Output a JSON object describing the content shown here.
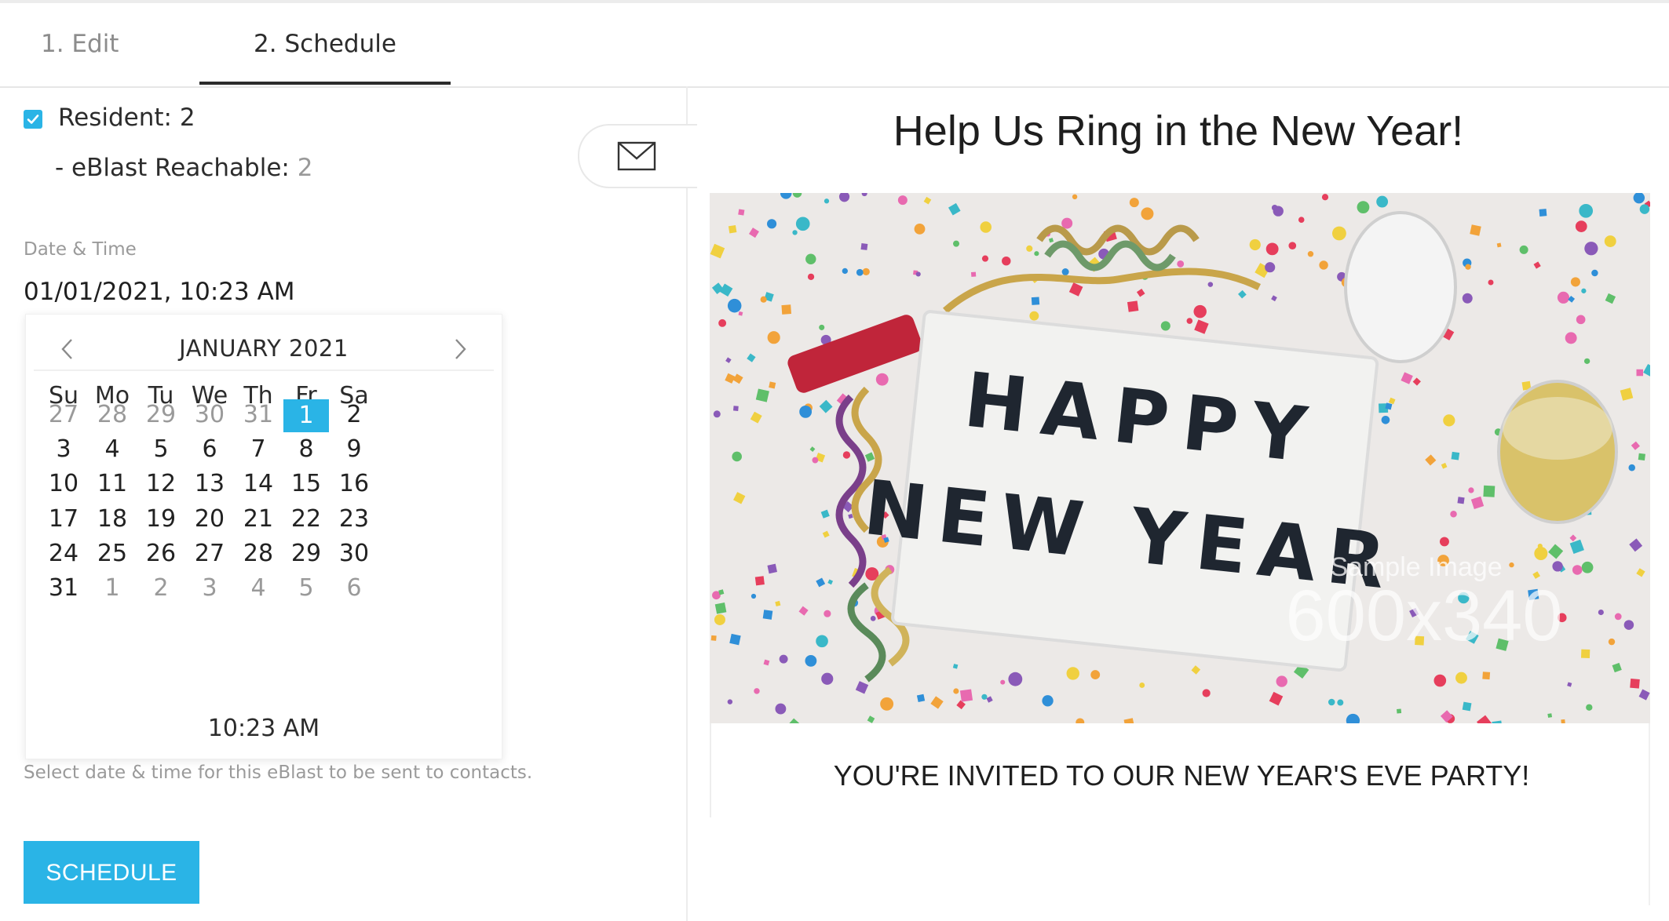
{
  "tabs": [
    {
      "label": "1. Edit",
      "active": false
    },
    {
      "label": "2. Schedule",
      "active": true
    }
  ],
  "recipients": {
    "resident_label": "Resident: 2",
    "resident_checked": true,
    "reachable_label": "- eBlast Reachable: ",
    "reachable_count": "2"
  },
  "datetime": {
    "label": "Date & Time",
    "value": "01/01/2021, 10:23 AM",
    "hint": "Select date & time for this eBlast to be sent to contacts."
  },
  "calendar": {
    "month_title": "JANUARY 2021",
    "weekdays": [
      "Su",
      "Mo",
      "Tu",
      "We",
      "Th",
      "Fr",
      "Sa"
    ],
    "weeks": [
      [
        "27",
        "28",
        "29",
        "30",
        "31",
        "1",
        "2"
      ],
      [
        "3",
        "4",
        "5",
        "6",
        "7",
        "8",
        "9"
      ],
      [
        "10",
        "11",
        "12",
        "13",
        "14",
        "15",
        "16"
      ],
      [
        "17",
        "18",
        "19",
        "20",
        "21",
        "22",
        "23"
      ],
      [
        "24",
        "25",
        "26",
        "27",
        "28",
        "29",
        "30"
      ],
      [
        "31",
        "1",
        "2",
        "3",
        "4",
        "5",
        "6"
      ]
    ],
    "muted": [
      [
        0,
        0
      ],
      [
        0,
        1
      ],
      [
        0,
        2
      ],
      [
        0,
        3
      ],
      [
        0,
        4
      ],
      [
        5,
        1
      ],
      [
        5,
        2
      ],
      [
        5,
        3
      ],
      [
        5,
        4
      ],
      [
        5,
        5
      ],
      [
        5,
        6
      ]
    ],
    "selected": [
      0,
      5
    ],
    "time": "10:23 AM"
  },
  "schedule_button": "SCHEDULE",
  "preview": {
    "headline": "Help Us Ring in the New Year!",
    "image_text": {
      "line1": "HAPPY",
      "line2": "NEW YEAR",
      "watermark_top": "Sample Image",
      "watermark_size": "600x340"
    },
    "invite": "YOU'RE INVITED TO OUR NEW YEAR'S EVE PARTY!"
  },
  "colors": {
    "accent": "#2ab4e6",
    "tab_underline": "#2b2b2b"
  },
  "icons": {
    "mail": "envelope-icon",
    "prev": "chevron-left-icon",
    "next": "chevron-right-icon",
    "checkbox": "checkmark-icon"
  }
}
